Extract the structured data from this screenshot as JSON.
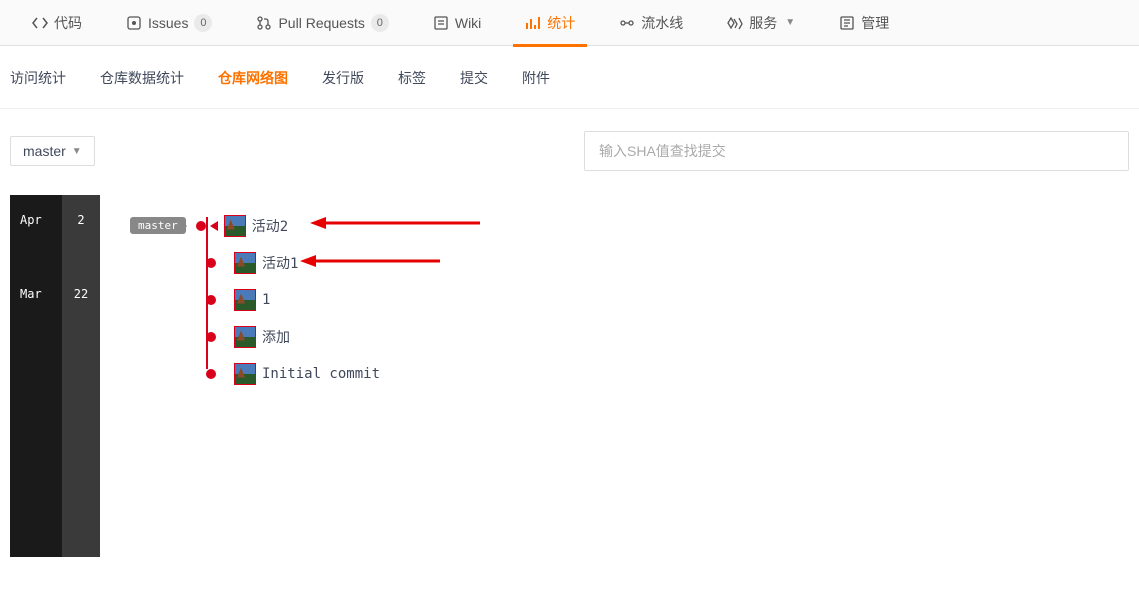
{
  "topNav": {
    "items": [
      {
        "label": "代码",
        "badge": null,
        "icon": "code",
        "active": false
      },
      {
        "label": "Issues",
        "badge": "0",
        "icon": "issue",
        "active": false
      },
      {
        "label": "Pull Requests",
        "badge": "0",
        "icon": "pr",
        "active": false
      },
      {
        "label": "Wiki",
        "badge": null,
        "icon": "wiki",
        "active": false
      },
      {
        "label": "统计",
        "badge": null,
        "icon": "stats",
        "active": true
      },
      {
        "label": "流水线",
        "badge": null,
        "icon": "pipeline",
        "active": false
      },
      {
        "label": "服务",
        "badge": null,
        "icon": "service",
        "active": false,
        "dropdown": true
      },
      {
        "label": "管理",
        "badge": null,
        "icon": "manage",
        "active": false
      }
    ]
  },
  "subNav": {
    "items": [
      {
        "label": "访问统计",
        "active": false
      },
      {
        "label": "仓库数据统计",
        "active": false
      },
      {
        "label": "仓库网络图",
        "active": true
      },
      {
        "label": "发行版",
        "active": false
      },
      {
        "label": "标签",
        "active": false
      },
      {
        "label": "提交",
        "active": false
      },
      {
        "label": "附件",
        "active": false
      }
    ]
  },
  "toolbar": {
    "branch": "master",
    "searchPlaceholder": "输入SHA值查找提交"
  },
  "timeline": {
    "months": [
      "Apr",
      "Mar"
    ],
    "days": [
      "2",
      "22"
    ]
  },
  "network": {
    "branchTag": "master",
    "commits": [
      {
        "msg": "活动2",
        "hasTag": true,
        "hasTri": true,
        "annotated": true
      },
      {
        "msg": "活动1",
        "hasTag": false,
        "hasTri": false,
        "annotated": true
      },
      {
        "msg": "1",
        "hasTag": false,
        "hasTri": false,
        "annotated": false
      },
      {
        "msg": "添加",
        "hasTag": false,
        "hasTri": false,
        "annotated": false
      },
      {
        "msg": "Initial commit",
        "hasTag": false,
        "hasTri": false,
        "annotated": false
      }
    ]
  },
  "colors": {
    "accent": "#fe7300",
    "commit": "#d9001b",
    "arrow": "#e60000"
  }
}
